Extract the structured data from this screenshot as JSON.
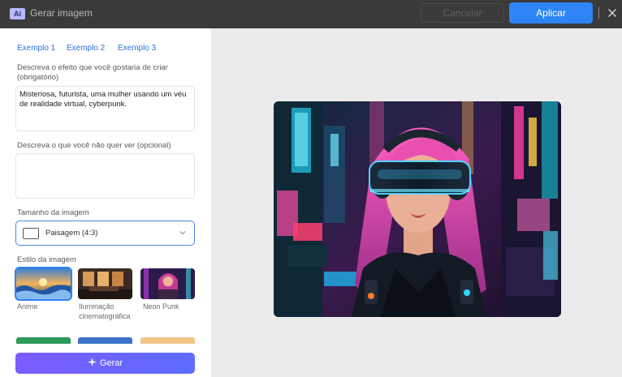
{
  "titlebar": {
    "badge": "Ai",
    "title": "Gerar imagem",
    "cancel_label": "Cancelar",
    "apply_label": "Aplicar",
    "close_icon": "close-icon"
  },
  "form": {
    "examples": [
      "Exemplo 1",
      "Exemplo 2",
      "Exemplo 3"
    ],
    "prompt_label": "Descreva o efeito que você gostaria de criar (obrigatório)",
    "prompt_value": "Misteriosa, futurista, uma mulher usando um véu de realidade virtual, cyberpunk.",
    "negative_label": "Descreva o que você não quer ver (opcional)",
    "negative_value": "",
    "size_label": "Tamanho da imagem",
    "size_value": "Paisagem (4:3)",
    "style_label": "Estilo da imagem",
    "styles": [
      {
        "name": "Anime",
        "selected": true
      },
      {
        "name": "Iluminação cinematográfica",
        "selected": false
      },
      {
        "name": "Neon Punk",
        "selected": false
      }
    ],
    "generate_label": "Gerar"
  },
  "colors": {
    "accent": "#2f84f5",
    "titlebar_bg": "#3a3a3a",
    "generate_start": "#7b5cff",
    "generate_end": "#5d6cff"
  }
}
